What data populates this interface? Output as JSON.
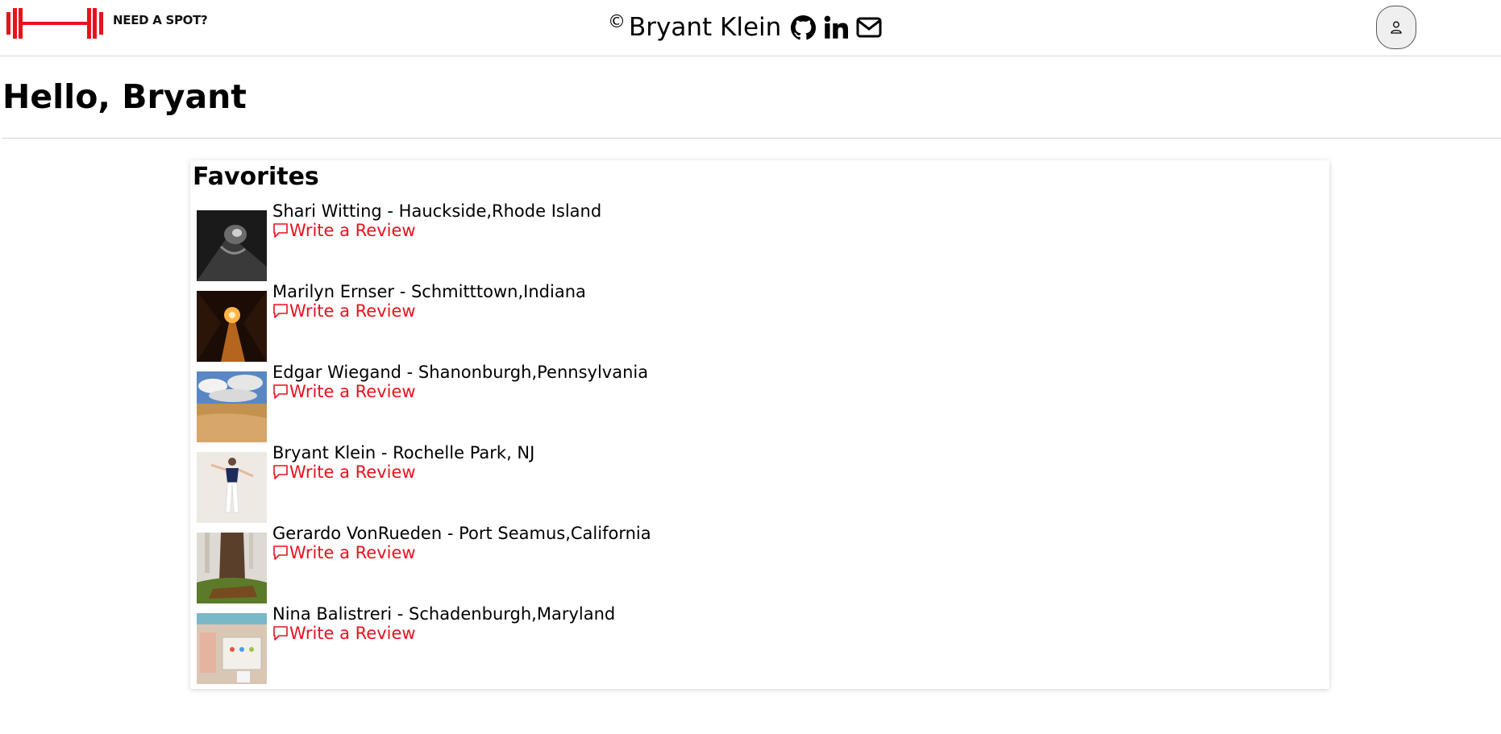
{
  "header": {
    "logo_text": "NEED A SPOT?",
    "copyright_symbol": "©",
    "author_name": "Bryant Klein",
    "icons": [
      "github-icon",
      "linkedin-icon",
      "envelope-icon"
    ],
    "user_icon": "person-icon"
  },
  "main": {
    "greeting": "Hello, Bryant"
  },
  "favorites": {
    "title": "Favorites",
    "review_label": "Write a Review",
    "accent_color": "#e8121d",
    "items": [
      {
        "title": "Shari Witting - Hauckside,Rhode Island"
      },
      {
        "title": "Marilyn Ernser - Schmitttown,Indiana"
      },
      {
        "title": "Edgar Wiegand - Shanonburgh,Pennsylvania"
      },
      {
        "title": "Bryant Klein - Rochelle Park, NJ"
      },
      {
        "title": "Gerardo VonRueden - Port Seamus,California"
      },
      {
        "title": "Nina Balistreri - Schadenburgh,Maryland"
      }
    ]
  }
}
